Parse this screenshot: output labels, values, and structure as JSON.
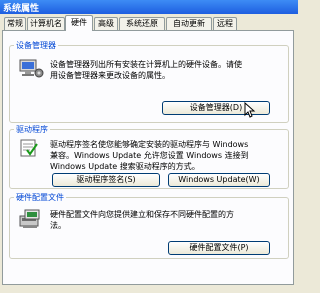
{
  "window": {
    "title": "系统属性"
  },
  "tabs": [
    {
      "label": "常规",
      "active": false
    },
    {
      "label": "计算机名",
      "active": false
    },
    {
      "label": "硬件",
      "active": true
    },
    {
      "label": "高级",
      "active": false
    },
    {
      "label": "系统还原",
      "active": false
    },
    {
      "label": "自动更新",
      "active": false
    },
    {
      "label": "远程",
      "active": false
    }
  ],
  "device_manager": {
    "title": "设备管理器",
    "desc_line1": "设备管理器列出所有安装在计算机上的硬件设备。请使",
    "desc_line2": "用设备管理器来更改设备的属性。",
    "button_label": "设备管理器(D)",
    "icon": "device-manager-icon"
  },
  "drivers": {
    "title": "驱动程序",
    "desc_line1": "驱动程序签名使您能够确定安装的驱动程序与 Windows",
    "desc_line2": "兼容。Windows Update 允许您设置 Windows 连接到",
    "desc_line3": "Windows Update 搜索驱动程序的方式。",
    "signing_button_label": "驱动程序签名(S)",
    "update_button_label": "Windows Update(W)",
    "icon": "driver-signing-icon"
  },
  "hardware_profiles": {
    "title": "硬件配置文件",
    "desc_line1": "硬件配置文件向您提供建立和保存不同硬件配置的方",
    "desc_line2": "法。",
    "button_label": "硬件配置文件(P)",
    "icon": "hardware-profile-icon"
  },
  "colors": {
    "group_title": "#0046d5",
    "titlebar": "#1e5ee0",
    "dialog_bg": "#ece9d8"
  }
}
